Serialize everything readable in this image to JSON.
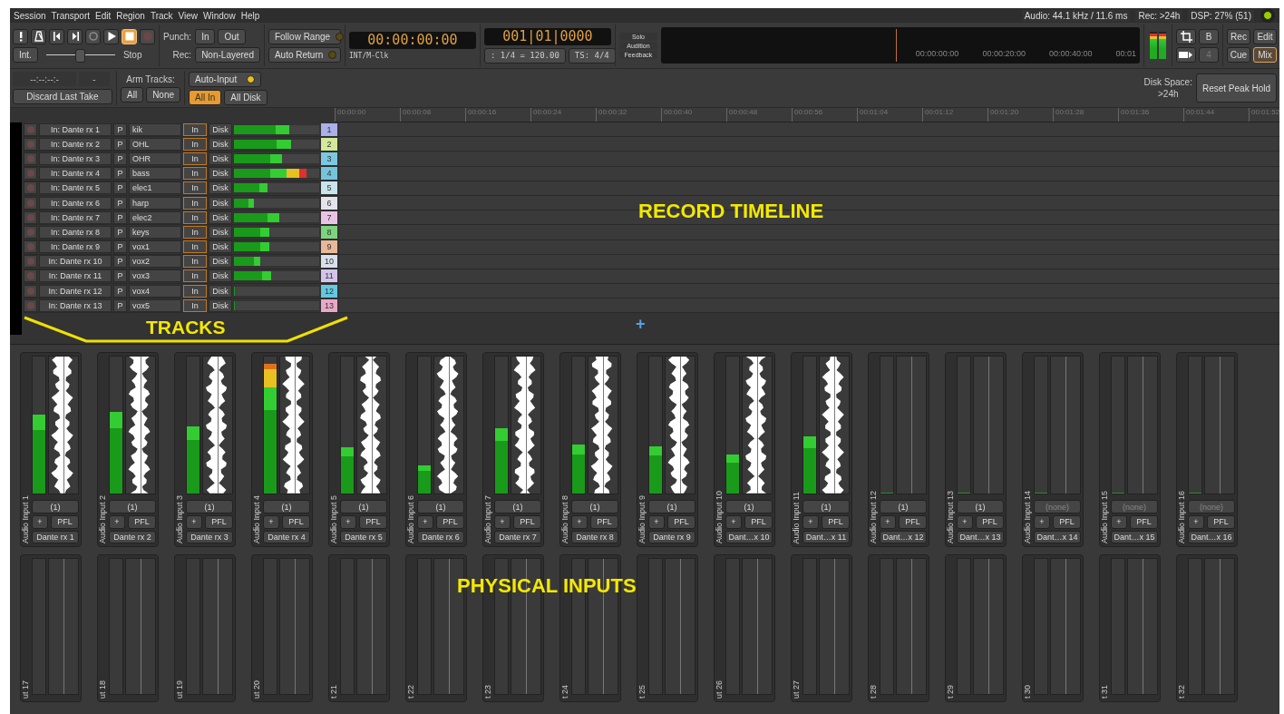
{
  "menu": [
    "Session",
    "Transport",
    "Edit",
    "Region",
    "Track",
    "View",
    "Window",
    "Help"
  ],
  "status": {
    "audio": "Audio: 44.1 kHz / 11.6 ms",
    "rec": "Rec: >24h",
    "dsp": "DSP: 27% (51)",
    "led_on": true
  },
  "transport": [
    {
      "kind": "panic",
      "on": false
    },
    {
      "kind": "metronome",
      "on": false
    },
    {
      "kind": "start",
      "on": false
    },
    {
      "kind": "end",
      "on": false
    },
    {
      "kind": "loop",
      "on": false
    },
    {
      "kind": "play",
      "on": false
    },
    {
      "kind": "stop",
      "on": true
    },
    {
      "kind": "record",
      "on": false
    }
  ],
  "sync_button": "Int.",
  "shuttle": {
    "level": 0.48
  },
  "shuttle_label": "Stop",
  "punch": {
    "label": "Punch:",
    "in": "In",
    "out": "Out",
    "rec_label": "Rec:",
    "mode": "Non-Layered"
  },
  "toggles": [
    {
      "label": "Follow Range",
      "on": false
    },
    {
      "label": "Auto Return",
      "on": false
    }
  ],
  "primary_clock": {
    "time": "00:00:00:00",
    "source": "INT/M-Clk"
  },
  "secondary_clock": {
    "time": "001|01|0000",
    "tempo": ": 1/4 = 120.00",
    "meter": "TS: 4/4"
  },
  "indicators": [
    "Solo",
    "Audition",
    "Feedback"
  ],
  "mini_timeline": [
    "00:00:00:00",
    "00:00:20:00",
    "00:00:40:00",
    "00:01"
  ],
  "view_buttons": [
    {
      "kind": "crop-icon",
      "selected": false
    },
    {
      "kind": "text",
      "label": "B",
      "selected": false
    },
    {
      "kind": "tape-icon",
      "selected": false
    },
    {
      "kind": "text",
      "label": "4",
      "selected": false
    }
  ],
  "page_buttons": [
    {
      "label": "Rec",
      "selected": false
    },
    {
      "label": "Edit",
      "selected": false
    },
    {
      "label": "Cue",
      "selected": false
    },
    {
      "label": "Mix",
      "selected": true
    }
  ],
  "take": {
    "time": "--:--:--:-",
    "count": "-",
    "discard": "Discard Last Take"
  },
  "arm": {
    "label": "Arm Tracks:",
    "all": "All",
    "none": "None"
  },
  "auto_input": {
    "label": "Auto-Input",
    "on": true
  },
  "monitor_buttons": [
    {
      "label": "All In",
      "selected": true
    },
    {
      "label": "All Disk",
      "selected": false
    }
  ],
  "disk": {
    "label": "Disk Space:",
    "value": ">24h"
  },
  "reset_button": "Reset Peak Hold",
  "ruler": [
    "00:00:00",
    "00:00:08",
    "00:00:16",
    "00:00:24",
    "00:00:32",
    "00:00:40",
    "00:00:48",
    "00:00:56",
    "00:01:04",
    "00:01:12",
    "00:01:20",
    "00:01:28",
    "00:01:36",
    "00:01:44",
    "00:01:52"
  ],
  "tracks": [
    {
      "input": "In: Dante rx 1",
      "p": "P",
      "name": "kik",
      "in": "In",
      "disk": "Disk",
      "monitor_input": true,
      "level": 0.65,
      "number": "1",
      "color": "#aab0e8"
    },
    {
      "input": "In: Dante rx 2",
      "p": "P",
      "name": "OHL",
      "in": "In",
      "disk": "Disk",
      "monitor_input": true,
      "level": 0.67,
      "number": "2",
      "color": "#d4e89a"
    },
    {
      "input": "In: Dante rx 3",
      "p": "P",
      "name": "OHR",
      "in": "In",
      "disk": "Disk",
      "monitor_input": true,
      "level": 0.56,
      "number": "3",
      "color": "#7cc8e0"
    },
    {
      "input": "In: Dante rx 4",
      "p": "P",
      "name": "bass",
      "in": "In",
      "disk": "Disk",
      "monitor_input": true,
      "level": 0.85,
      "number": "4",
      "color": "#74c4dc"
    },
    {
      "input": "In: Dante rx 5",
      "p": "P",
      "name": "elec1",
      "in": "In",
      "disk": "Disk",
      "monitor_input": true,
      "level": 0.39,
      "number": "5",
      "color": "#c8e4ec"
    },
    {
      "input": "In: Dante rx 6",
      "p": "P",
      "name": "harp",
      "in": "In",
      "disk": "Disk",
      "monitor_input": true,
      "level": 0.23,
      "number": "6",
      "color": "#e4e4ec"
    },
    {
      "input": "In: Dante rx 7",
      "p": "P",
      "name": "elec2",
      "in": "In",
      "disk": "Disk",
      "monitor_input": true,
      "level": 0.53,
      "number": "7",
      "color": "#e8c4e4"
    },
    {
      "input": "In: Dante rx 8",
      "p": "P",
      "name": "keys",
      "in": "In",
      "disk": "Disk",
      "monitor_input": true,
      "level": 0.41,
      "number": "8",
      "color": "#7cd47c"
    },
    {
      "input": "In: Dante rx 9",
      "p": "P",
      "name": "vox1",
      "in": "In",
      "disk": "Disk",
      "monitor_input": true,
      "level": 0.41,
      "number": "9",
      "color": "#e8b898"
    },
    {
      "input": "In: Dante rx 10",
      "p": "P",
      "name": "vox2",
      "in": "In",
      "disk": "Disk",
      "monitor_input": true,
      "level": 0.31,
      "number": "10",
      "color": "#d8e0ec"
    },
    {
      "input": "In: Dante rx 11",
      "p": "P",
      "name": "vox3",
      "in": "In",
      "disk": "Disk",
      "monitor_input": true,
      "level": 0.44,
      "number": "11",
      "color": "#d4c4ec"
    },
    {
      "input": "In: Dante rx 12",
      "p": "P",
      "name": "vox4",
      "in": "In",
      "disk": "Disk",
      "monitor_input": true,
      "level": 0,
      "number": "12",
      "color": "#64c8e0"
    },
    {
      "input": "In: Dante rx 13",
      "p": "P",
      "name": "vox5",
      "in": "In",
      "disk": "Disk",
      "monitor_input": true,
      "level": 0,
      "number": "13",
      "color": "#e8a8c8"
    }
  ],
  "add_track": "+",
  "annotations": [
    {
      "kind": "timeline",
      "text": "RECORD TIMELINE"
    },
    {
      "kind": "tracks",
      "text": "TRACKS"
    },
    {
      "kind": "inputs",
      "text": "PHYSICAL INPUTS"
    }
  ],
  "inputs": [
    {
      "name": "Audio Input 1",
      "level": 0.58,
      "signal": true,
      "port": "(1)",
      "add": "+",
      "pfl": "PFL",
      "label": "Dante rx 1"
    },
    {
      "name": "Audio Input 2",
      "level": 0.6,
      "signal": true,
      "port": "(1)",
      "add": "+",
      "pfl": "PFL",
      "label": "Dante rx 2"
    },
    {
      "name": "Audio Input 3",
      "level": 0.49,
      "signal": true,
      "port": "(1)",
      "add": "+",
      "pfl": "PFL",
      "label": "Dante rx 3"
    },
    {
      "name": "Audio Input 4",
      "level": 0.95,
      "signal": true,
      "port": "(1)",
      "add": "+",
      "pfl": "PFL",
      "label": "Dante rx 4"
    },
    {
      "name": "Audio Input 5",
      "level": 0.34,
      "signal": true,
      "port": "(1)",
      "add": "+",
      "pfl": "PFL",
      "label": "Dante rx 5"
    },
    {
      "name": "Audio Input 6",
      "level": 0.21,
      "signal": true,
      "port": "(1)",
      "add": "+",
      "pfl": "PFL",
      "label": "Dante rx 6"
    },
    {
      "name": "Audio Input 7",
      "level": 0.48,
      "signal": true,
      "port": "(1)",
      "add": "+",
      "pfl": "PFL",
      "label": "Dante rx 7"
    },
    {
      "name": "Audio Input 8",
      "level": 0.36,
      "signal": true,
      "port": "(1)",
      "add": "+",
      "pfl": "PFL",
      "label": "Dante rx 8"
    },
    {
      "name": "Audio Input 9",
      "level": 0.35,
      "signal": true,
      "port": "(1)",
      "add": "+",
      "pfl": "PFL",
      "label": "Dante rx 9"
    },
    {
      "name": "Audio Input 10",
      "level": 0.29,
      "signal": true,
      "port": "(1)",
      "add": "+",
      "pfl": "PFL",
      "label": "Dant…x 10"
    },
    {
      "name": "Audio Input 11",
      "level": 0.42,
      "signal": true,
      "port": "(1)",
      "add": "+",
      "pfl": "PFL",
      "label": "Dant…x 11"
    },
    {
      "name": "Audio Input 12",
      "level": 0,
      "signal": false,
      "port": "(1)",
      "add": "+",
      "pfl": "PFL",
      "label": "Dant…x 12"
    },
    {
      "name": "Audio Input 13",
      "level": 0,
      "signal": false,
      "port": "(1)",
      "add": "+",
      "pfl": "PFL",
      "label": "Dant…x 13"
    },
    {
      "name": "Audio Input 14",
      "level": 0,
      "signal": false,
      "port": "(none)",
      "add": "+",
      "pfl": "PFL",
      "label": "Dant…x 14"
    },
    {
      "name": "Audio Input 15",
      "level": 0,
      "signal": false,
      "port": "(none)",
      "add": "+",
      "pfl": "PFL",
      "label": "Dant…x 15"
    },
    {
      "name": "Audio Input 16",
      "level": 0,
      "signal": false,
      "port": "(none)",
      "add": "+",
      "pfl": "PFL",
      "label": "Dant…x 16"
    }
  ],
  "inputs_row_2": [
    "ut 17",
    "ut 18",
    "ut 19",
    "ut 20",
    "t 21",
    "t 22",
    "t 23",
    "t 24",
    "t 25",
    "ut 26",
    "ut 27",
    "t 28",
    "t 29",
    "t 30",
    "t 31",
    "t 32"
  ]
}
